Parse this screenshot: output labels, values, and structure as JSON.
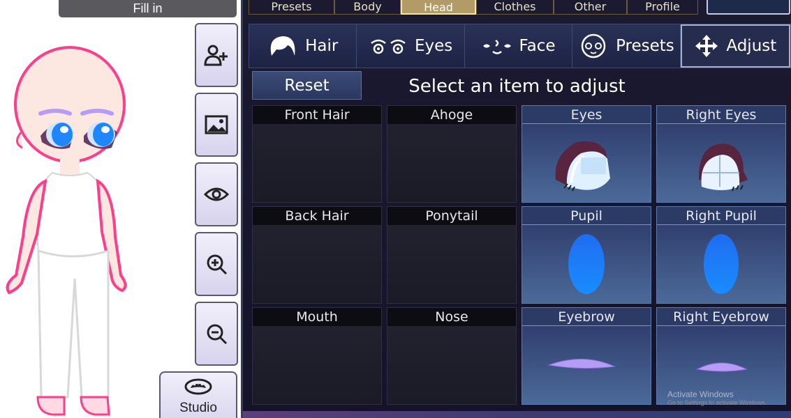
{
  "fill_button": {
    "label": "Fill in"
  },
  "side_buttons": [
    {
      "icon": "add-user-icon"
    },
    {
      "icon": "image-icon"
    },
    {
      "icon": "eye-icon"
    },
    {
      "icon": "zoom-in-icon"
    },
    {
      "icon": "zoom-out-icon"
    }
  ],
  "studio": {
    "label": "Studio",
    "icon": "bat-mask-icon"
  },
  "top_tabs": [
    {
      "label": "Presets",
      "active": false
    },
    {
      "label": "Body",
      "active": false
    },
    {
      "label": "Head",
      "active": true
    },
    {
      "label": "Clothes",
      "active": false
    },
    {
      "label": "Other",
      "active": false
    },
    {
      "label": "Profile",
      "active": false
    }
  ],
  "sub_tabs": [
    {
      "label": "Hair",
      "icon": "hair-icon",
      "active": false
    },
    {
      "label": "Eyes",
      "icon": "eyes-icon",
      "active": false
    },
    {
      "label": "Face",
      "icon": "face-icon",
      "active": false
    },
    {
      "label": "Presets",
      "icon": "face-preset-icon",
      "active": false
    },
    {
      "label": "Adjust",
      "icon": "move-arrows-icon",
      "active": true
    }
  ],
  "reset": {
    "label": "Reset"
  },
  "message": "Select an item to adjust",
  "grid": [
    {
      "label": "Front Hair",
      "selected": false
    },
    {
      "label": "Ahoge",
      "selected": false
    },
    {
      "label": "Eyes",
      "selected": true,
      "preview": "eye"
    },
    {
      "label": "Right Eyes",
      "selected": true,
      "preview": "eye-right"
    },
    {
      "label": "Back Hair",
      "selected": false
    },
    {
      "label": "Ponytail",
      "selected": false
    },
    {
      "label": "Pupil",
      "selected": true,
      "preview": "pupil"
    },
    {
      "label": "Right Pupil",
      "selected": true,
      "preview": "pupil"
    },
    {
      "label": "Mouth",
      "selected": false
    },
    {
      "label": "Nose",
      "selected": false
    },
    {
      "label": "Eyebrow",
      "selected": true,
      "preview": "eyebrow"
    },
    {
      "label": "Right Eyebrow",
      "selected": true,
      "preview": "eyebrow-small"
    }
  ],
  "watermark": {
    "line1": "Activate Windows",
    "line2": "Go to Settings to activate Windows."
  },
  "colors": {
    "panel_bg": "#1b1a31",
    "outline_pink": "#ff3d8a",
    "eye_blue": "#1e86ff",
    "brow_purple": "#b79cf6",
    "active_tab": "#b39b67"
  }
}
